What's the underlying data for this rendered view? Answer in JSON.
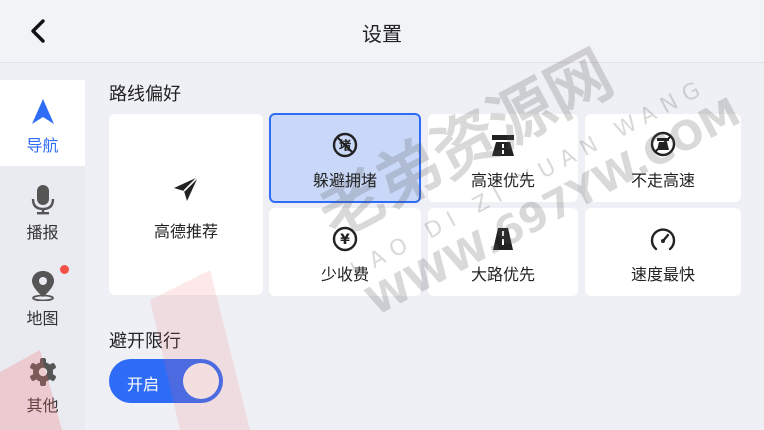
{
  "header": {
    "title": "设置"
  },
  "sidebar": {
    "items": [
      {
        "label": "导航",
        "icon": "navigation-arrow-icon",
        "active": true
      },
      {
        "label": "播报",
        "icon": "microphone-icon"
      },
      {
        "label": "地图",
        "icon": "map-pin-icon",
        "badge": true
      },
      {
        "label": "其他",
        "icon": "gear-icon"
      }
    ]
  },
  "route_pref": {
    "title": "路线偏好",
    "options": [
      {
        "label": "高德推荐",
        "icon": "paper-plane-icon"
      },
      {
        "label": "躲避拥堵",
        "icon": "avoid-congestion-icon",
        "selected": true,
        "icon_text": "堵"
      },
      {
        "label": "高速优先",
        "icon": "highway-icon"
      },
      {
        "label": "不走高速",
        "icon": "no-highway-icon"
      },
      {
        "label": "少收费",
        "icon": "yen-icon",
        "icon_text": "¥"
      },
      {
        "label": "大路优先",
        "icon": "road-icon"
      },
      {
        "label": "速度最快",
        "icon": "speedometer-icon"
      }
    ]
  },
  "restriction": {
    "title": "避开限行",
    "toggle_label": "开启",
    "enabled": true
  },
  "watermark": {
    "main": "老弟资源网",
    "pinyin": "LAO DI ZI YUAN WANG",
    "url": "WWW.697YW.COM"
  },
  "colors": {
    "accent": "#2f6cf6",
    "badge": "#f25246"
  }
}
